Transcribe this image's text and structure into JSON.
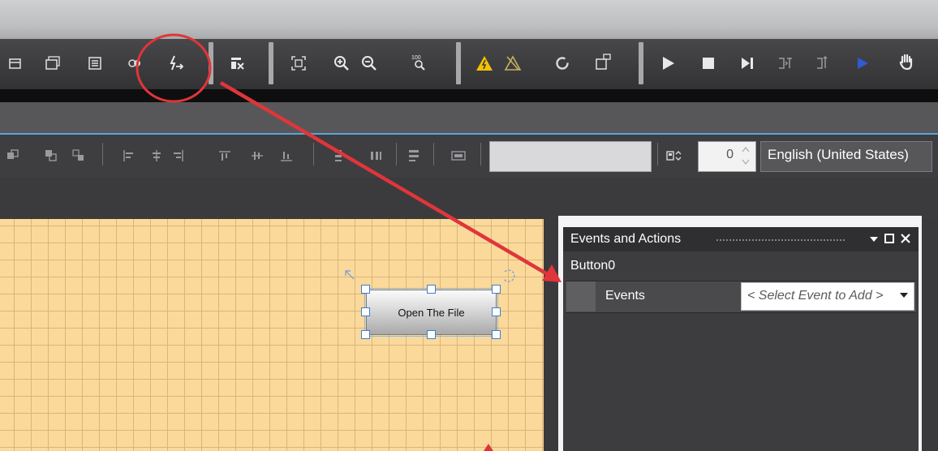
{
  "toolbar": {
    "icons": [
      "window-icon",
      "window-stack-icon",
      "list-icon",
      "link-icon",
      "event-actions-icon",
      "edit-icon",
      "fit-frame-icon",
      "zoom-in-icon",
      "zoom-out-icon",
      "zoom-100-icon",
      "warning-icon",
      "warning-off-icon",
      "refresh-icon",
      "device-icon",
      "play-icon",
      "stop-icon",
      "step-icon",
      "step-into-icon",
      "step-out-icon",
      "run-blue-icon",
      "hand-icon"
    ]
  },
  "layout_toolbar": {
    "zoom_value": "0",
    "language": "English (United States)"
  },
  "canvas": {
    "button_label": "Open The File"
  },
  "panel": {
    "title": "Events and Actions",
    "object_name": "Button0",
    "row_label": "Events",
    "select_placeholder": "< Select Event to Add >"
  },
  "colors": {
    "annotation": "#e0353a",
    "canvas": "#fbd99a",
    "accent_line": "#5ba3d8"
  }
}
